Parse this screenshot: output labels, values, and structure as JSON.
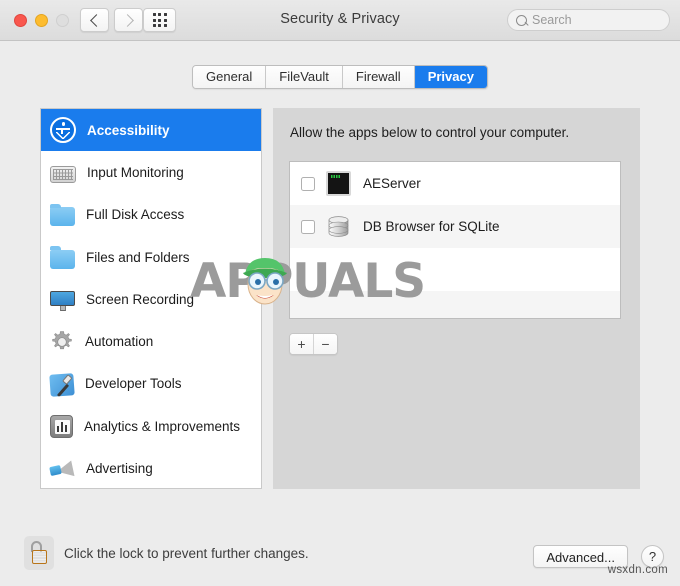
{
  "window": {
    "title": "Security & Privacy",
    "traffic_lights": [
      "close",
      "minimize",
      "zoom"
    ],
    "nav": {
      "back": "‹",
      "forward": "›"
    },
    "grid_button": "all-preferences-grid"
  },
  "search": {
    "placeholder": "Search",
    "value": "",
    "icon": "search-icon"
  },
  "tabs": [
    {
      "label": "General",
      "active": false
    },
    {
      "label": "FileVault",
      "active": false
    },
    {
      "label": "Firewall",
      "active": false
    },
    {
      "label": "Privacy",
      "active": true
    }
  ],
  "sidebar": {
    "items": [
      {
        "label": "Accessibility",
        "icon": "accessibility-icon",
        "selected": true
      },
      {
        "label": "Input Monitoring",
        "icon": "keyboard-icon",
        "selected": false
      },
      {
        "label": "Full Disk Access",
        "icon": "folder-icon",
        "selected": false
      },
      {
        "label": "Files and Folders",
        "icon": "folder-icon",
        "selected": false
      },
      {
        "label": "Screen Recording",
        "icon": "display-icon",
        "selected": false
      },
      {
        "label": "Automation",
        "icon": "gear-icon",
        "selected": false
      },
      {
        "label": "Developer Tools",
        "icon": "hammer-icon",
        "selected": false
      },
      {
        "label": "Analytics & Improvements",
        "icon": "bar-chart-icon",
        "selected": false
      },
      {
        "label": "Advertising",
        "icon": "megaphone-icon",
        "selected": false
      }
    ]
  },
  "right_pane": {
    "description": "Allow the apps below to control your computer.",
    "apps": [
      {
        "name": "AEServer",
        "checked": false,
        "icon": "terminal-icon"
      },
      {
        "name": "DB Browser for SQLite",
        "checked": false,
        "icon": "database-icon"
      }
    ],
    "add_button": "+",
    "remove_button": "−"
  },
  "footer": {
    "lock_icon": "unlocked-padlock-icon",
    "lock_text": "Click the lock to prevent further changes.",
    "advanced_label": "Advanced...",
    "help_label": "?"
  },
  "watermark": {
    "text": "APPUALS",
    "credit": "wsxdn.com"
  },
  "colors": {
    "accent_blue": "#1a7ced",
    "window_bg": "#ececec",
    "pane_bg": "#d6d6d6",
    "list_bg": "#ffffff"
  }
}
